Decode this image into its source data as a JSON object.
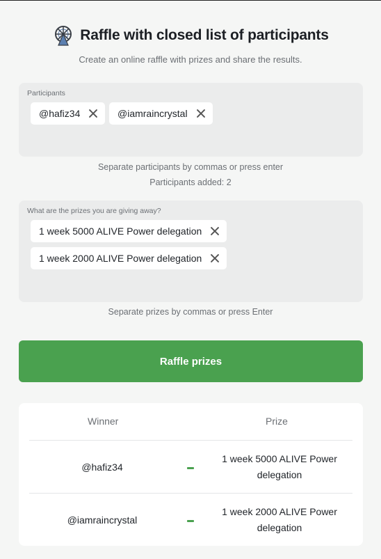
{
  "header": {
    "title": "Raffle with closed list of participants",
    "subtitle": "Create an online raffle with prizes and share the results."
  },
  "participants": {
    "label": "Participants",
    "items": [
      "@hafiz34",
      "@iamraincrystal"
    ],
    "hint": "Separate participants by commas or press enter",
    "count_text": "Participants added: 2"
  },
  "prizes": {
    "label": "What are the prizes you are giving away?",
    "items": [
      "1 week 5000 ALIVE Power delegation",
      "1 week 2000 ALIVE Power delegation"
    ],
    "hint": "Separate prizes by commas or press Enter"
  },
  "action": {
    "label": "Raffle prizes"
  },
  "results": {
    "winner_header": "Winner",
    "prize_header": "Prize",
    "rows": [
      {
        "winner": "@hafiz34",
        "prize": "1 week 5000 ALIVE Power delegation"
      },
      {
        "winner": "@iamraincrystal",
        "prize": "1 week 2000 ALIVE Power delegation"
      }
    ]
  },
  "colors": {
    "accent": "#4aa14f",
    "background": "#f5f6f5",
    "field": "#ebecec",
    "logo": "#5b7fb0"
  },
  "icons": {
    "logo": "ferris-wheel-icon",
    "remove": "close-icon"
  }
}
